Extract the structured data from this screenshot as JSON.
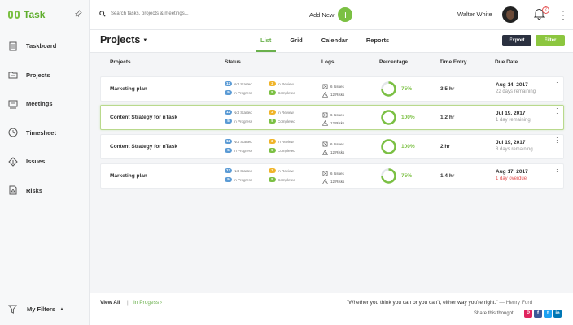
{
  "app": {
    "logo_text": "Task"
  },
  "colors": {
    "accent": "#7bc043",
    "not_started": "#5b9bd5",
    "in_progress": "#5b9bd5",
    "in_review": "#f0b429",
    "completed": "#7bc043",
    "overdue": "#e55353",
    "export_btn": "#2b3140"
  },
  "sidebar": {
    "items": [
      {
        "label": "Taskboard",
        "icon": "taskboard-icon"
      },
      {
        "label": "Projects",
        "icon": "projects-icon"
      },
      {
        "label": "Meetings",
        "icon": "meetings-icon"
      },
      {
        "label": "Timesheet",
        "icon": "clock-icon"
      },
      {
        "label": "Issues",
        "icon": "issues-icon"
      },
      {
        "label": "Risks",
        "icon": "risks-icon"
      }
    ],
    "filters_label": "My Filters"
  },
  "topbar": {
    "search_placeholder": "Search tasks, projects & meetings...",
    "add_new_label": "Add New",
    "user_name": "Walter White",
    "notification_count": "2"
  },
  "header": {
    "title": "Projects",
    "tabs": [
      "List",
      "Grid",
      "Calendar",
      "Reports"
    ],
    "active_tab": "List",
    "export_label": "Export",
    "filter_label": "Filter"
  },
  "table": {
    "columns": [
      "Projects",
      "Status",
      "Logs",
      "Percentage",
      "Time Entry",
      "Due Date"
    ],
    "rows": [
      {
        "name": "Marketing plan",
        "status": [
          {
            "count": "12",
            "label": "Not Started"
          },
          {
            "count": "2",
            "label": "In Review"
          },
          {
            "count": "5",
            "label": "In Progress"
          },
          {
            "count": "5",
            "label": "Completed"
          }
        ],
        "logs": [
          "6 Issues",
          "12 Risks"
        ],
        "percentage": "75%",
        "progress": 0.75,
        "time": "3.5 hr",
        "due_date": "Aug 14, 2017",
        "remaining": "22 days remaining",
        "overdue": false
      },
      {
        "name": "Content Strategy for nTask",
        "status": [
          {
            "count": "12",
            "label": "Not Started"
          },
          {
            "count": "2",
            "label": "In Review"
          },
          {
            "count": "5",
            "label": "In Progress"
          },
          {
            "count": "5",
            "label": "Completed"
          }
        ],
        "logs": [
          "6 Issues",
          "12 Risks"
        ],
        "percentage": "100%",
        "progress": 1.0,
        "time": "1.2 hr",
        "due_date": "Jul 19, 2017",
        "remaining": "1 day remaining",
        "overdue": false
      },
      {
        "name": "Content Strategy for nTask",
        "status": [
          {
            "count": "12",
            "label": "Not Started"
          },
          {
            "count": "2",
            "label": "In Review"
          },
          {
            "count": "5",
            "label": "In Progress"
          },
          {
            "count": "5",
            "label": "Completed"
          }
        ],
        "logs": [
          "6 Issues",
          "12 Risks"
        ],
        "percentage": "100%",
        "progress": 1.0,
        "time": "2 hr",
        "due_date": "Jul 19, 2017",
        "remaining": "8 days remaining",
        "overdue": false
      },
      {
        "name": "Marketing plan",
        "status": [
          {
            "count": "12",
            "label": "Not Started"
          },
          {
            "count": "2",
            "label": "In Review"
          },
          {
            "count": "5",
            "label": "In Progress"
          },
          {
            "count": "5",
            "label": "Completed"
          }
        ],
        "logs": [
          "6 Issues",
          "12 Risks"
        ],
        "percentage": "75%",
        "progress": 0.75,
        "time": "1.4 hr",
        "due_date": "Aug 17, 2017",
        "remaining": "1 day overdue",
        "overdue": true
      }
    ]
  },
  "footer": {
    "view_all": "View All",
    "separator": "|",
    "in_progress": "In Progess",
    "quote": "\"Whether you think you can or you can't, either way you're right.\"",
    "quote_author": "— Henry Ford",
    "share_label": "Share this thought:",
    "social": [
      "P",
      "f",
      "t",
      "in"
    ]
  }
}
